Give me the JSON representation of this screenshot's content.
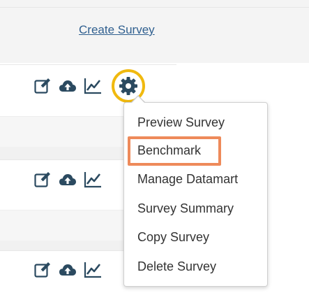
{
  "header": {
    "create_survey_label": "Create Survey"
  },
  "rows": [
    {
      "icons": [
        "edit-icon",
        "cloud-upload-icon",
        "chart-icon"
      ]
    },
    {
      "icons": [
        "edit-icon",
        "cloud-upload-icon",
        "chart-icon"
      ]
    },
    {
      "icons": [
        "edit-icon",
        "cloud-upload-icon",
        "chart-icon"
      ]
    }
  ],
  "context_menu": {
    "items": [
      {
        "label": "Preview Survey"
      },
      {
        "label": "Benchmark",
        "highlighted": true
      },
      {
        "label": "Manage Datamart"
      },
      {
        "label": "Survey Summary"
      },
      {
        "label": "Copy Survey"
      },
      {
        "label": "Delete Survey"
      }
    ]
  },
  "colors": {
    "link": "#2f5f8f",
    "icon": "#2b4a60",
    "gear_ring": "#f0b90f",
    "highlight": "#ee8a5a"
  }
}
